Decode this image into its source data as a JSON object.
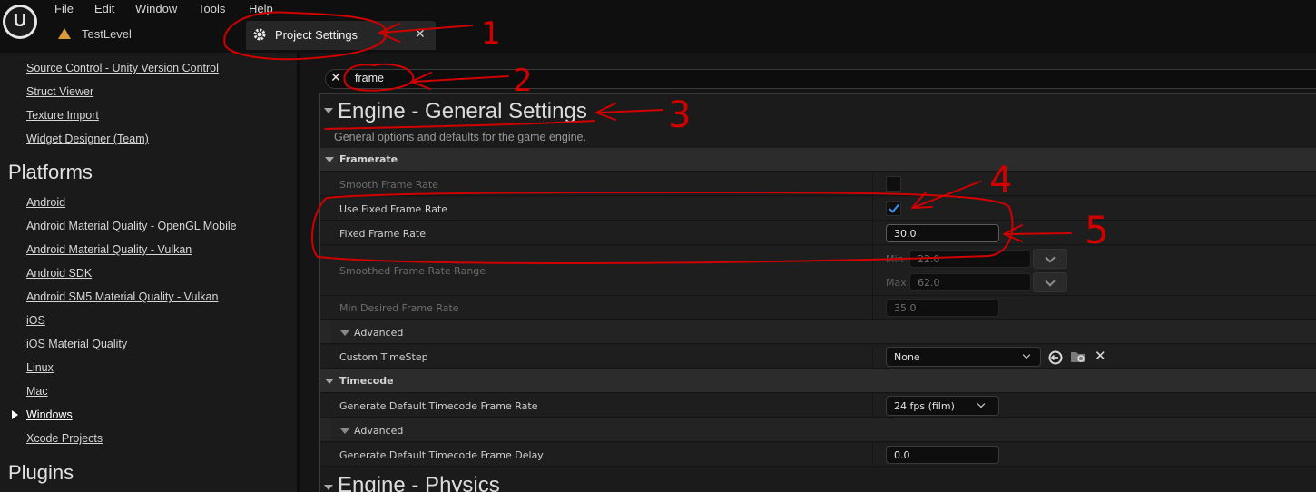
{
  "menu_bar": {
    "items": [
      "File",
      "Edit",
      "Window",
      "Tools",
      "Help"
    ]
  },
  "tabs": {
    "level_tab": "TestLevel",
    "settings_tab": "Project Settings"
  },
  "sidebar": {
    "items_top": [
      "Source Control - Unity Version Control",
      "Struct Viewer",
      "Texture Import",
      "Widget Designer (Team)"
    ],
    "platforms_heading": "Platforms",
    "platforms": [
      "Android",
      "Android Material Quality - OpenGL Mobile",
      "Android Material Quality - Vulkan",
      "Android SDK",
      "Android SM5 Material Quality - Vulkan",
      "iOS",
      "iOS Material Quality",
      "Linux",
      "Mac",
      "Windows",
      "Xcode Projects"
    ],
    "selected": "Windows",
    "plugins_heading": "Plugins"
  },
  "search": {
    "value": "frame"
  },
  "section": {
    "title": "Engine - General Settings",
    "description": "General options and defaults for the game engine.",
    "next_title": "Engine - Physics"
  },
  "framerate": {
    "category": "Framerate",
    "smooth_frame_rate_label": "Smooth Frame Rate",
    "smooth_frame_rate": false,
    "use_fixed_frame_rate_label": "Use Fixed Frame Rate",
    "use_fixed_frame_rate": true,
    "fixed_frame_rate_label": "Fixed Frame Rate",
    "fixed_frame_rate": "30.0",
    "smoothed_range_label": "Smoothed Frame Rate Range",
    "min_label": "Min",
    "min_value": "22.0",
    "max_label": "Max",
    "max_value": "62.0",
    "min_desired_label": "Min Desired Frame Rate",
    "min_desired_value": "35.0",
    "advanced_label": "Advanced",
    "custom_timestep_label": "Custom TimeStep",
    "custom_timestep_value": "None"
  },
  "timecode": {
    "category": "Timecode",
    "default_frame_rate_label": "Generate Default Timecode Frame Rate",
    "default_frame_rate_value": "24 fps (film)",
    "advanced_label": "Advanced",
    "frame_delay_label": "Generate Default Timecode Frame Delay",
    "frame_delay_value": "0.0"
  },
  "annotations": {
    "numbers": [
      "1",
      "2",
      "3",
      "4",
      "5"
    ],
    "ink_color": "#d00000"
  }
}
